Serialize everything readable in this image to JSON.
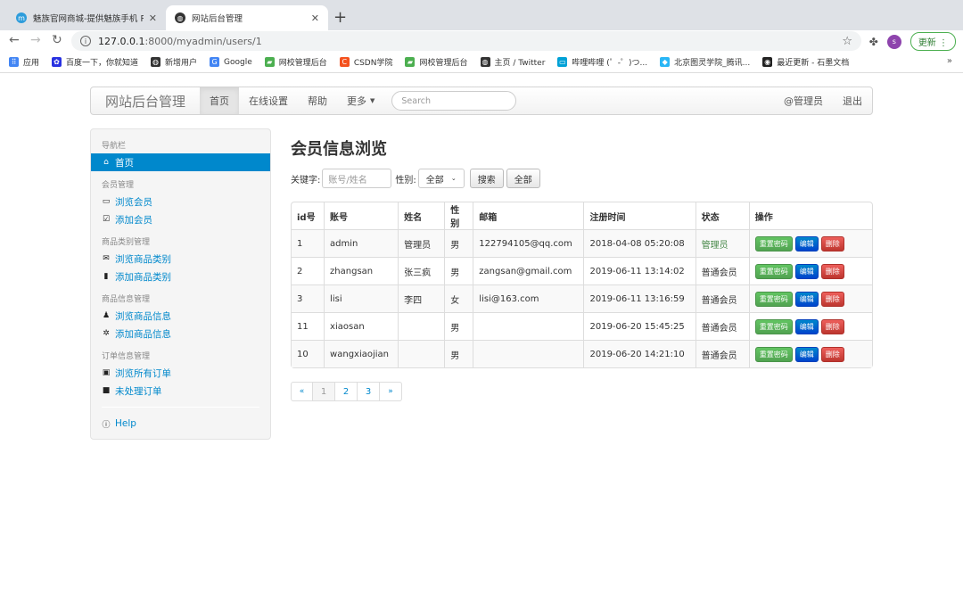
{
  "browser": {
    "tabs": [
      {
        "title": "魅族官网商城-提供魅族手机 PRO",
        "favicon": "meizu-icon"
      },
      {
        "title": "网站后台管理",
        "favicon": "globe-icon"
      }
    ],
    "new_tab": "+",
    "url_host": "127.0.0.1",
    "url_path": ":8000/myadmin/users/1",
    "profile_initial": "s",
    "update_label": "更新",
    "bookmarks": [
      {
        "label": "应用",
        "icon": "apps-grid-icon",
        "color": "#4285f4"
      },
      {
        "label": "百度一下，你就知道",
        "icon": "baidu-paw-icon",
        "color": "#2932e1"
      },
      {
        "label": "新增用户",
        "icon": "globe-icon",
        "color": "#333333"
      },
      {
        "label": "Google",
        "icon": "google-g-icon",
        "color": "#4285f4"
      },
      {
        "label": "网校管理后台",
        "icon": "green-folder-icon",
        "color": "#4caf50"
      },
      {
        "label": "CSDN学院",
        "icon": "csdn-c-icon",
        "color": "#f4511e"
      },
      {
        "label": "网校管理后台",
        "icon": "green-folder-icon",
        "color": "#4caf50"
      },
      {
        "label": "主页 / Twitter",
        "icon": "globe-icon",
        "color": "#333333"
      },
      {
        "label": "哔哩哔哩 (゜-゜)つ...",
        "icon": "bilibili-tv-icon",
        "color": "#00a1d6"
      },
      {
        "label": "北京图灵学院_腾讯...",
        "icon": "diamond-icon",
        "color": "#29b6f6"
      },
      {
        "label": "最近更新 - 石墨文档",
        "icon": "shimo-icon",
        "color": "#222222"
      }
    ],
    "more": "»"
  },
  "navbar": {
    "brand": "网站后台管理",
    "items": [
      "首页",
      "在线设置",
      "帮助"
    ],
    "more_label": "更多",
    "search_placeholder": "Search",
    "user": "@管理员",
    "logout": "退出"
  },
  "sidebar": {
    "nav_header": "导航栏",
    "home": "首页",
    "groups": [
      {
        "header": "会员管理",
        "links": [
          {
            "label": "浏览会员",
            "icon": "folder-open-icon"
          },
          {
            "label": "添加会员",
            "icon": "check-square-icon"
          }
        ]
      },
      {
        "header": "商品类别管理",
        "links": [
          {
            "label": "浏览商品类别",
            "icon": "envelope-icon"
          },
          {
            "label": "添加商品类别",
            "icon": "file-icon"
          }
        ]
      },
      {
        "header": "商品信息管理",
        "links": [
          {
            "label": "浏览商品信息",
            "icon": "user-icon"
          },
          {
            "label": "添加商品信息",
            "icon": "cog-icon"
          }
        ]
      },
      {
        "header": "订单信息管理",
        "links": [
          {
            "label": "浏览所有订单",
            "icon": "picture-icon"
          },
          {
            "label": "未处理订单",
            "icon": "stop-icon"
          }
        ]
      }
    ],
    "help": "Help"
  },
  "main": {
    "title": "会员信息浏览",
    "search": {
      "keyword_label": "关键字:",
      "keyword_placeholder": "账号/姓名",
      "gender_label": "性别:",
      "gender_selected": "全部",
      "search_button": "搜索",
      "all_button": "全部"
    },
    "table": {
      "headers": [
        "id号",
        "账号",
        "姓名",
        "性别",
        "邮箱",
        "注册时间",
        "状态",
        "操作"
      ],
      "rows": [
        {
          "id": "1",
          "account": "admin",
          "name": "管理员",
          "gender": "男",
          "email": "122794105@qq.com",
          "registered": "2018-04-08 05:20:08",
          "status": "管理员"
        },
        {
          "id": "2",
          "account": "zhangsan",
          "name": "张三疯",
          "gender": "男",
          "email": "zangsan@gmail.com",
          "registered": "2019-06-11 13:14:02",
          "status": "普通会员"
        },
        {
          "id": "3",
          "account": "lisi",
          "name": "李四",
          "gender": "女",
          "email": "lisi@163.com",
          "registered": "2019-06-11 13:16:59",
          "status": "普通会员"
        },
        {
          "id": "11",
          "account": "xiaosan",
          "name": "",
          "gender": "男",
          "email": "",
          "registered": "2019-06-20 15:45:25",
          "status": "普通会员"
        },
        {
          "id": "10",
          "account": "wangxiaojian",
          "name": "",
          "gender": "男",
          "email": "",
          "registered": "2019-06-20 14:21:10",
          "status": "普通会员"
        }
      ],
      "actions": {
        "reset": "重置密码",
        "edit": "编辑",
        "delete": "删除"
      }
    },
    "pagination": [
      "«",
      "1",
      "2",
      "3",
      "»"
    ]
  }
}
